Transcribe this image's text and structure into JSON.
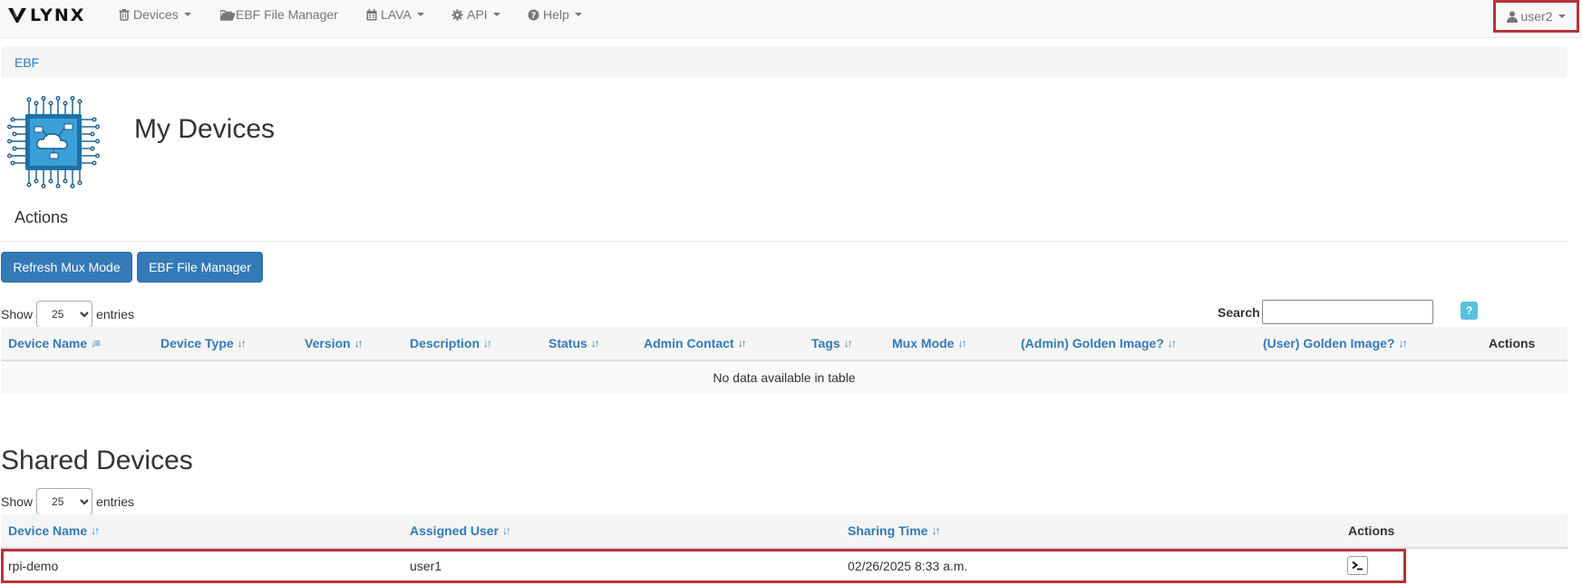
{
  "navbar": {
    "brand": "LYNX",
    "items": [
      {
        "label": "Devices",
        "icon": "trash-icon",
        "dropdown": true
      },
      {
        "label": "EBF File Manager",
        "icon": "folder-open-icon",
        "dropdown": false
      },
      {
        "label": "LAVA",
        "icon": "calendar-icon",
        "dropdown": true
      },
      {
        "label": "API",
        "icon": "gear-icon",
        "dropdown": true
      },
      {
        "label": "Help",
        "icon": "question-circle-icon",
        "dropdown": true
      }
    ],
    "user": "user2"
  },
  "breadcrumb": {
    "item": "EBF"
  },
  "header": {
    "title": "My Devices"
  },
  "actions": {
    "heading": "Actions",
    "buttons": [
      "Refresh Mux Mode",
      "EBF File Manager"
    ]
  },
  "my_devices_table": {
    "show_label": "Show",
    "entries_label": "entries",
    "page_size": "25",
    "search_label": "Search",
    "search_value": "",
    "help_label": "?",
    "columns": [
      "Device Name",
      "Device Type",
      "Version",
      "Description",
      "Status",
      "Admin Contact",
      "Tags",
      "Mux Mode",
      "(Admin) Golden Image?",
      "(User) Golden Image?",
      "Actions"
    ],
    "empty_message": "No data available in table"
  },
  "shared_devices": {
    "title": "Shared Devices",
    "show_label": "Show",
    "entries_label": "entries",
    "page_size": "25",
    "columns": [
      "Device Name",
      "Assigned User",
      "Sharing Time",
      "Actions"
    ],
    "rows": [
      {
        "device_name": "rpi-demo",
        "assigned_user": "user1",
        "sharing_time": "02/26/2025 8:33 a.m.",
        "action_icon": "terminal-icon"
      }
    ]
  },
  "colors": {
    "primary": "#337ab7",
    "info": "#5bc0de",
    "highlight": "#b5343a",
    "navbar_bg": "#f8f8f8"
  }
}
